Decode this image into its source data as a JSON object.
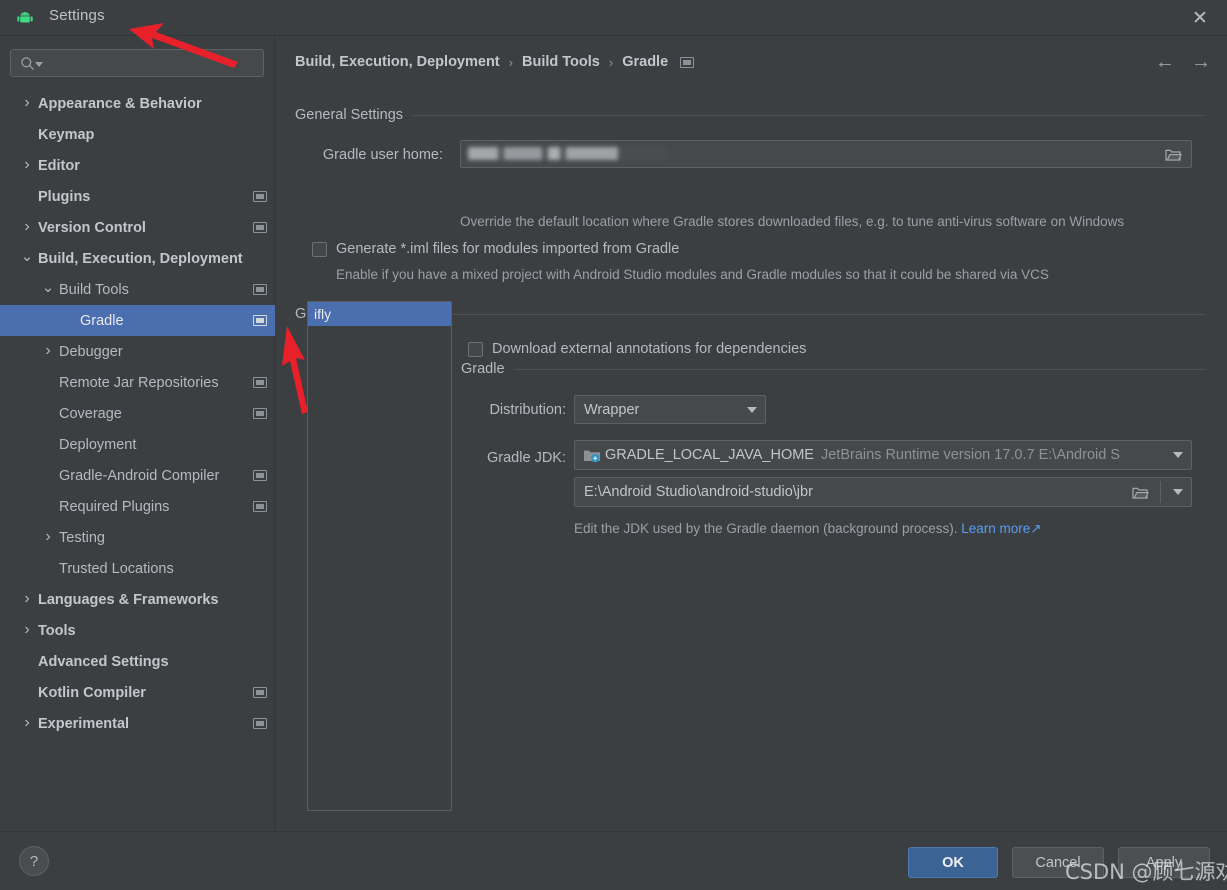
{
  "window": {
    "title": "Settings",
    "app_icon": "android-robot-icon",
    "close_label": "✕"
  },
  "sidebar": {
    "search": {
      "value": "",
      "placeholder": "",
      "icon": "search-icon"
    },
    "items": [
      {
        "label": "Appearance & Behavior",
        "indent": 0,
        "chevron": "right",
        "bold": true,
        "badge": false,
        "selected": false
      },
      {
        "label": "Keymap",
        "indent": 0,
        "chevron": "none",
        "bold": true,
        "badge": false,
        "selected": false
      },
      {
        "label": "Editor",
        "indent": 0,
        "chevron": "right",
        "bold": true,
        "badge": false,
        "selected": false
      },
      {
        "label": "Plugins",
        "indent": 0,
        "chevron": "none",
        "bold": true,
        "badge": true,
        "selected": false
      },
      {
        "label": "Version Control",
        "indent": 0,
        "chevron": "right",
        "bold": true,
        "badge": true,
        "selected": false
      },
      {
        "label": "Build, Execution, Deployment",
        "indent": 0,
        "chevron": "down",
        "bold": true,
        "badge": false,
        "selected": false
      },
      {
        "label": "Build Tools",
        "indent": 1,
        "chevron": "down",
        "bold": false,
        "badge": true,
        "selected": false
      },
      {
        "label": "Gradle",
        "indent": 2,
        "chevron": "none",
        "bold": false,
        "badge": true,
        "selected": true
      },
      {
        "label": "Debugger",
        "indent": 1,
        "chevron": "right",
        "bold": false,
        "badge": false,
        "selected": false
      },
      {
        "label": "Remote Jar Repositories",
        "indent": 1,
        "chevron": "none",
        "bold": false,
        "badge": true,
        "selected": false
      },
      {
        "label": "Coverage",
        "indent": 1,
        "chevron": "none",
        "bold": false,
        "badge": true,
        "selected": false
      },
      {
        "label": "Deployment",
        "indent": 1,
        "chevron": "none",
        "bold": false,
        "badge": false,
        "selected": false
      },
      {
        "label": "Gradle-Android Compiler",
        "indent": 1,
        "chevron": "none",
        "bold": false,
        "badge": true,
        "selected": false
      },
      {
        "label": "Required Plugins",
        "indent": 1,
        "chevron": "none",
        "bold": false,
        "badge": true,
        "selected": false
      },
      {
        "label": "Testing",
        "indent": 1,
        "chevron": "right",
        "bold": false,
        "badge": false,
        "selected": false
      },
      {
        "label": "Trusted Locations",
        "indent": 1,
        "chevron": "none",
        "bold": false,
        "badge": false,
        "selected": false
      },
      {
        "label": "Languages & Frameworks",
        "indent": 0,
        "chevron": "right",
        "bold": true,
        "badge": false,
        "selected": false
      },
      {
        "label": "Tools",
        "indent": 0,
        "chevron": "right",
        "bold": true,
        "badge": false,
        "selected": false
      },
      {
        "label": "Advanced Settings",
        "indent": 0,
        "chevron": "none",
        "bold": true,
        "badge": false,
        "selected": false
      },
      {
        "label": "Kotlin Compiler",
        "indent": 0,
        "chevron": "none",
        "bold": true,
        "badge": true,
        "selected": false
      },
      {
        "label": "Experimental",
        "indent": 0,
        "chevron": "right",
        "bold": true,
        "badge": true,
        "selected": false
      }
    ]
  },
  "main": {
    "breadcrumb": [
      "Build, Execution, Deployment",
      "Build Tools",
      "Gradle"
    ],
    "breadcrumb_separator": "›",
    "nav_back": "←",
    "nav_forward": "→",
    "general_settings": {
      "group_title": "General Settings",
      "gradle_user_home_label": "Gradle user home:",
      "gradle_user_home_value": "",
      "gradle_user_home_hint": "Override the default location where Gradle stores downloaded files, e.g. to tune anti-virus software on Windows",
      "generate_iml_label": "Generate *.iml files for modules imported from Gradle",
      "generate_iml_checked": false,
      "generate_iml_hint": "Enable if you have a mixed project with Android Studio modules and Gradle modules so that it could be shared via VCS"
    },
    "gradle_projects": {
      "group_title": "Gradle Projects",
      "projects": [
        {
          "name": "ifly",
          "selected": true
        }
      ],
      "download_annotations_label": "Download external annotations for dependencies",
      "download_annotations_checked": false,
      "gradle_group_title": "Gradle",
      "distribution_label": "Distribution:",
      "distribution_value": "Wrapper",
      "gradle_jdk_label": "Gradle JDK:",
      "gradle_jdk_value": "GRADLE_LOCAL_JAVA_HOME",
      "gradle_jdk_detail": "JetBrains Runtime version 17.0.7 E:\\Android S",
      "gradle_jdk_path": "E:\\Android Studio\\android-studio\\jbr",
      "jdk_hint_text": "Edit the JDK used by the Gradle daemon (background process). ",
      "jdk_hint_link": "Learn more",
      "jdk_hint_link_arrow": "↗"
    }
  },
  "footer": {
    "help_label": "?",
    "ok_label": "OK",
    "cancel_label": "Cancel",
    "apply_label": "Apply"
  },
  "overlay": {
    "watermark": "CSDN @顾七源劝"
  },
  "colors": {
    "background": "#3c3f41",
    "selection": "#4b6eaf",
    "accent_button": "#3b6394",
    "link": "#589df6",
    "annotation_arrow": "#e8202a",
    "android_green": "#3ddc84"
  }
}
